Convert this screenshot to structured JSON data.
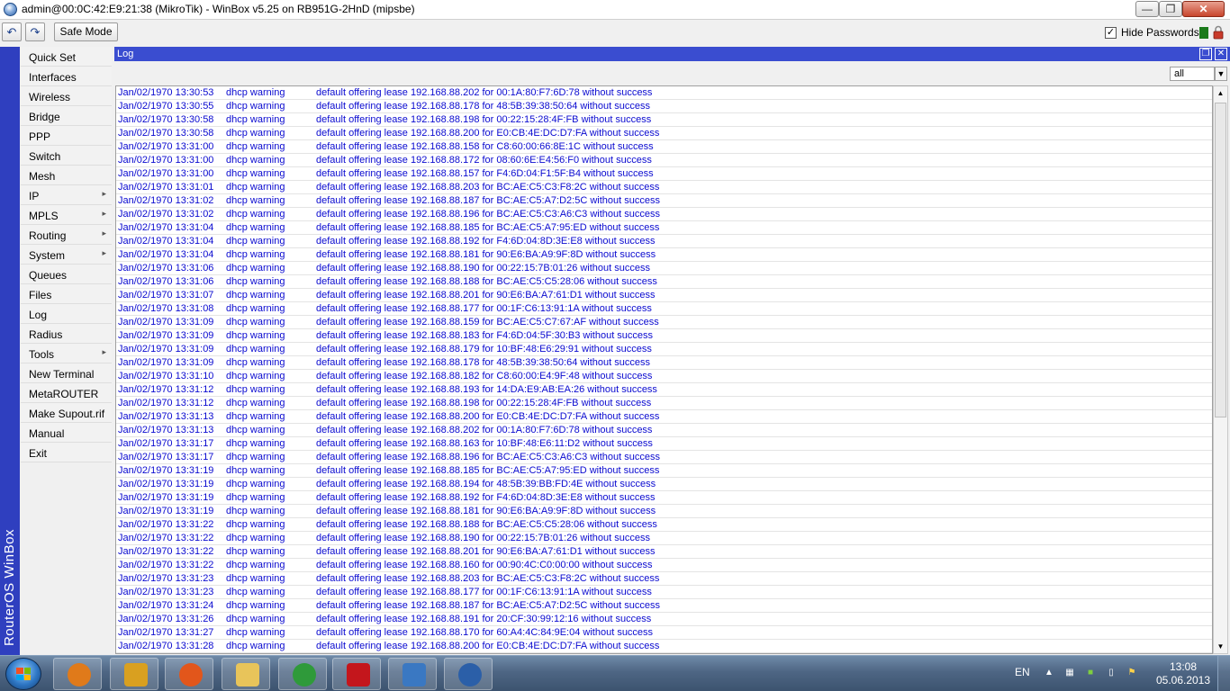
{
  "window": {
    "title": "admin@00:0C:42:E9:21:38 (MikroTik) - WinBox v5.25 on RB951G-2HnD (mipsbe)",
    "min_icon": "minimize-icon",
    "max_icon": "maximize-icon",
    "close_icon": "close-icon"
  },
  "toolbar": {
    "undo_icon": "undo-icon",
    "redo_icon": "redo-icon",
    "safe_mode_label": "Safe Mode",
    "hide_passwords_label": "Hide Passwords",
    "hide_passwords_checked": true,
    "status_color": "#1b7a1b",
    "lock_icon": "lock-icon"
  },
  "brand": {
    "vertical_text": "RouterOS WinBox"
  },
  "menu": {
    "items": [
      {
        "label": "Quick Set",
        "submenu": false
      },
      {
        "label": "Interfaces",
        "submenu": false
      },
      {
        "label": "Wireless",
        "submenu": false
      },
      {
        "label": "Bridge",
        "submenu": false
      },
      {
        "label": "PPP",
        "submenu": false
      },
      {
        "label": "Switch",
        "submenu": false
      },
      {
        "label": "Mesh",
        "submenu": false
      },
      {
        "label": "IP",
        "submenu": true
      },
      {
        "label": "MPLS",
        "submenu": true
      },
      {
        "label": "Routing",
        "submenu": true
      },
      {
        "label": "System",
        "submenu": true
      },
      {
        "label": "Queues",
        "submenu": false
      },
      {
        "label": "Files",
        "submenu": false
      },
      {
        "label": "Log",
        "submenu": false
      },
      {
        "label": "Radius",
        "submenu": false
      },
      {
        "label": "Tools",
        "submenu": true
      },
      {
        "label": "New Terminal",
        "submenu": false
      },
      {
        "label": "MetaROUTER",
        "submenu": false
      },
      {
        "label": "Make Supout.rif",
        "submenu": false
      },
      {
        "label": "Manual",
        "submenu": false
      },
      {
        "label": "Exit",
        "submenu": false
      }
    ]
  },
  "log": {
    "title": "Log",
    "filter_value": "all",
    "entries": [
      {
        "time": "Jan/02/1970 13:30:53",
        "topic": "dhcp warning",
        "message": "default offering lease 192.168.88.202 for 00:1A:80:F7:6D:78 without success"
      },
      {
        "time": "Jan/02/1970 13:30:55",
        "topic": "dhcp warning",
        "message": "default offering lease 192.168.88.178 for 48:5B:39:38:50:64 without success"
      },
      {
        "time": "Jan/02/1970 13:30:58",
        "topic": "dhcp warning",
        "message": "default offering lease 192.168.88.198 for 00:22:15:28:4F:FB without success"
      },
      {
        "time": "Jan/02/1970 13:30:58",
        "topic": "dhcp warning",
        "message": "default offering lease 192.168.88.200 for E0:CB:4E:DC:D7:FA without success"
      },
      {
        "time": "Jan/02/1970 13:31:00",
        "topic": "dhcp warning",
        "message": "default offering lease 192.168.88.158 for C8:60:00:66:8E:1C without success"
      },
      {
        "time": "Jan/02/1970 13:31:00",
        "topic": "dhcp warning",
        "message": "default offering lease 192.168.88.172 for 08:60:6E:E4:56:F0 without success"
      },
      {
        "time": "Jan/02/1970 13:31:00",
        "topic": "dhcp warning",
        "message": "default offering lease 192.168.88.157 for F4:6D:04:F1:5F:B4 without success"
      },
      {
        "time": "Jan/02/1970 13:31:01",
        "topic": "dhcp warning",
        "message": "default offering lease 192.168.88.203 for BC:AE:C5:C3:F8:2C without success"
      },
      {
        "time": "Jan/02/1970 13:31:02",
        "topic": "dhcp warning",
        "message": "default offering lease 192.168.88.187 for BC:AE:C5:A7:D2:5C without success"
      },
      {
        "time": "Jan/02/1970 13:31:02",
        "topic": "dhcp warning",
        "message": "default offering lease 192.168.88.196 for BC:AE:C5:C3:A6:C3 without success"
      },
      {
        "time": "Jan/02/1970 13:31:04",
        "topic": "dhcp warning",
        "message": "default offering lease 192.168.88.185 for BC:AE:C5:A7:95:ED without success"
      },
      {
        "time": "Jan/02/1970 13:31:04",
        "topic": "dhcp warning",
        "message": "default offering lease 192.168.88.192 for F4:6D:04:8D:3E:E8 without success"
      },
      {
        "time": "Jan/02/1970 13:31:04",
        "topic": "dhcp warning",
        "message": "default offering lease 192.168.88.181 for 90:E6:BA:A9:9F:8D without success"
      },
      {
        "time": "Jan/02/1970 13:31:06",
        "topic": "dhcp warning",
        "message": "default offering lease 192.168.88.190 for 00:22:15:7B:01:26 without success"
      },
      {
        "time": "Jan/02/1970 13:31:06",
        "topic": "dhcp warning",
        "message": "default offering lease 192.168.88.188 for BC:AE:C5:C5:28:06 without success"
      },
      {
        "time": "Jan/02/1970 13:31:07",
        "topic": "dhcp warning",
        "message": "default offering lease 192.168.88.201 for 90:E6:BA:A7:61:D1 without success"
      },
      {
        "time": "Jan/02/1970 13:31:08",
        "topic": "dhcp warning",
        "message": "default offering lease 192.168.88.177 for 00:1F:C6:13:91:1A without success"
      },
      {
        "time": "Jan/02/1970 13:31:09",
        "topic": "dhcp warning",
        "message": "default offering lease 192.168.88.159 for BC:AE:C5:C7:67:AF without success"
      },
      {
        "time": "Jan/02/1970 13:31:09",
        "topic": "dhcp warning",
        "message": "default offering lease 192.168.88.183 for F4:6D:04:5F:30:B3 without success"
      },
      {
        "time": "Jan/02/1970 13:31:09",
        "topic": "dhcp warning",
        "message": "default offering lease 192.168.88.179 for 10:BF:48:E6:29:91 without success"
      },
      {
        "time": "Jan/02/1970 13:31:09",
        "topic": "dhcp warning",
        "message": "default offering lease 192.168.88.178 for 48:5B:39:38:50:64 without success"
      },
      {
        "time": "Jan/02/1970 13:31:10",
        "topic": "dhcp warning",
        "message": "default offering lease 192.168.88.182 for C8:60:00:E4:9F:48 without success"
      },
      {
        "time": "Jan/02/1970 13:31:12",
        "topic": "dhcp warning",
        "message": "default offering lease 192.168.88.193 for 14:DA:E9:AB:EA:26 without success"
      },
      {
        "time": "Jan/02/1970 13:31:12",
        "topic": "dhcp warning",
        "message": "default offering lease 192.168.88.198 for 00:22:15:28:4F:FB without success"
      },
      {
        "time": "Jan/02/1970 13:31:13",
        "topic": "dhcp warning",
        "message": "default offering lease 192.168.88.200 for E0:CB:4E:DC:D7:FA without success"
      },
      {
        "time": "Jan/02/1970 13:31:13",
        "topic": "dhcp warning",
        "message": "default offering lease 192.168.88.202 for 00:1A:80:F7:6D:78 without success"
      },
      {
        "time": "Jan/02/1970 13:31:17",
        "topic": "dhcp warning",
        "message": "default offering lease 192.168.88.163 for 10:BF:48:E6:11:D2 without success"
      },
      {
        "time": "Jan/02/1970 13:31:17",
        "topic": "dhcp warning",
        "message": "default offering lease 192.168.88.196 for BC:AE:C5:C3:A6:C3 without success"
      },
      {
        "time": "Jan/02/1970 13:31:19",
        "topic": "dhcp warning",
        "message": "default offering lease 192.168.88.185 for BC:AE:C5:A7:95:ED without success"
      },
      {
        "time": "Jan/02/1970 13:31:19",
        "topic": "dhcp warning",
        "message": "default offering lease 192.168.88.194 for 48:5B:39:BB:FD:4E without success"
      },
      {
        "time": "Jan/02/1970 13:31:19",
        "topic": "dhcp warning",
        "message": "default offering lease 192.168.88.192 for F4:6D:04:8D:3E:E8 without success"
      },
      {
        "time": "Jan/02/1970 13:31:19",
        "topic": "dhcp warning",
        "message": "default offering lease 192.168.88.181 for 90:E6:BA:A9:9F:8D without success"
      },
      {
        "time": "Jan/02/1970 13:31:22",
        "topic": "dhcp warning",
        "message": "default offering lease 192.168.88.188 for BC:AE:C5:C5:28:06 without success"
      },
      {
        "time": "Jan/02/1970 13:31:22",
        "topic": "dhcp warning",
        "message": "default offering lease 192.168.88.190 for 00:22:15:7B:01:26 without success"
      },
      {
        "time": "Jan/02/1970 13:31:22",
        "topic": "dhcp warning",
        "message": "default offering lease 192.168.88.201 for 90:E6:BA:A7:61:D1 without success"
      },
      {
        "time": "Jan/02/1970 13:31:22",
        "topic": "dhcp warning",
        "message": "default offering lease 192.168.88.160 for 00:90:4C:C0:00:00 without success"
      },
      {
        "time": "Jan/02/1970 13:31:23",
        "topic": "dhcp warning",
        "message": "default offering lease 192.168.88.203 for BC:AE:C5:C3:F8:2C without success"
      },
      {
        "time": "Jan/02/1970 13:31:23",
        "topic": "dhcp warning",
        "message": "default offering lease 192.168.88.177 for 00:1F:C6:13:91:1A without success"
      },
      {
        "time": "Jan/02/1970 13:31:24",
        "topic": "dhcp warning",
        "message": "default offering lease 192.168.88.187 for BC:AE:C5:A7:D2:5C without success"
      },
      {
        "time": "Jan/02/1970 13:31:26",
        "topic": "dhcp warning",
        "message": "default offering lease 192.168.88.191 for 20:CF:30:99:12:16 without success"
      },
      {
        "time": "Jan/02/1970 13:31:27",
        "topic": "dhcp warning",
        "message": "default offering lease 192.168.88.170 for 60:A4:4C:84:9E:04 without success"
      },
      {
        "time": "Jan/02/1970 13:31:28",
        "topic": "dhcp warning",
        "message": "default offering lease 192.168.88.200 for E0:CB:4E:DC:D7:FA without success"
      }
    ]
  },
  "taskbar": {
    "start_icon": "windows-start-icon",
    "apps": [
      {
        "name": "media-player-icon",
        "color": "#e07a1a"
      },
      {
        "name": "control-panel-icon",
        "color": "#d9a020"
      },
      {
        "name": "firefox-icon",
        "color": "#e2561b"
      },
      {
        "name": "explorer-folder-icon",
        "color": "#e8c45a"
      },
      {
        "name": "chrome-icon",
        "color": "#2f9a3a"
      },
      {
        "name": "kaspersky-icon",
        "color": "#c4161c"
      },
      {
        "name": "remote-desktop-icon",
        "color": "#3a78c2"
      },
      {
        "name": "winbox-icon",
        "color": "#2b5fa8"
      }
    ],
    "language": "EN",
    "clock_time": "13:08",
    "clock_date": "05.06.2013"
  }
}
